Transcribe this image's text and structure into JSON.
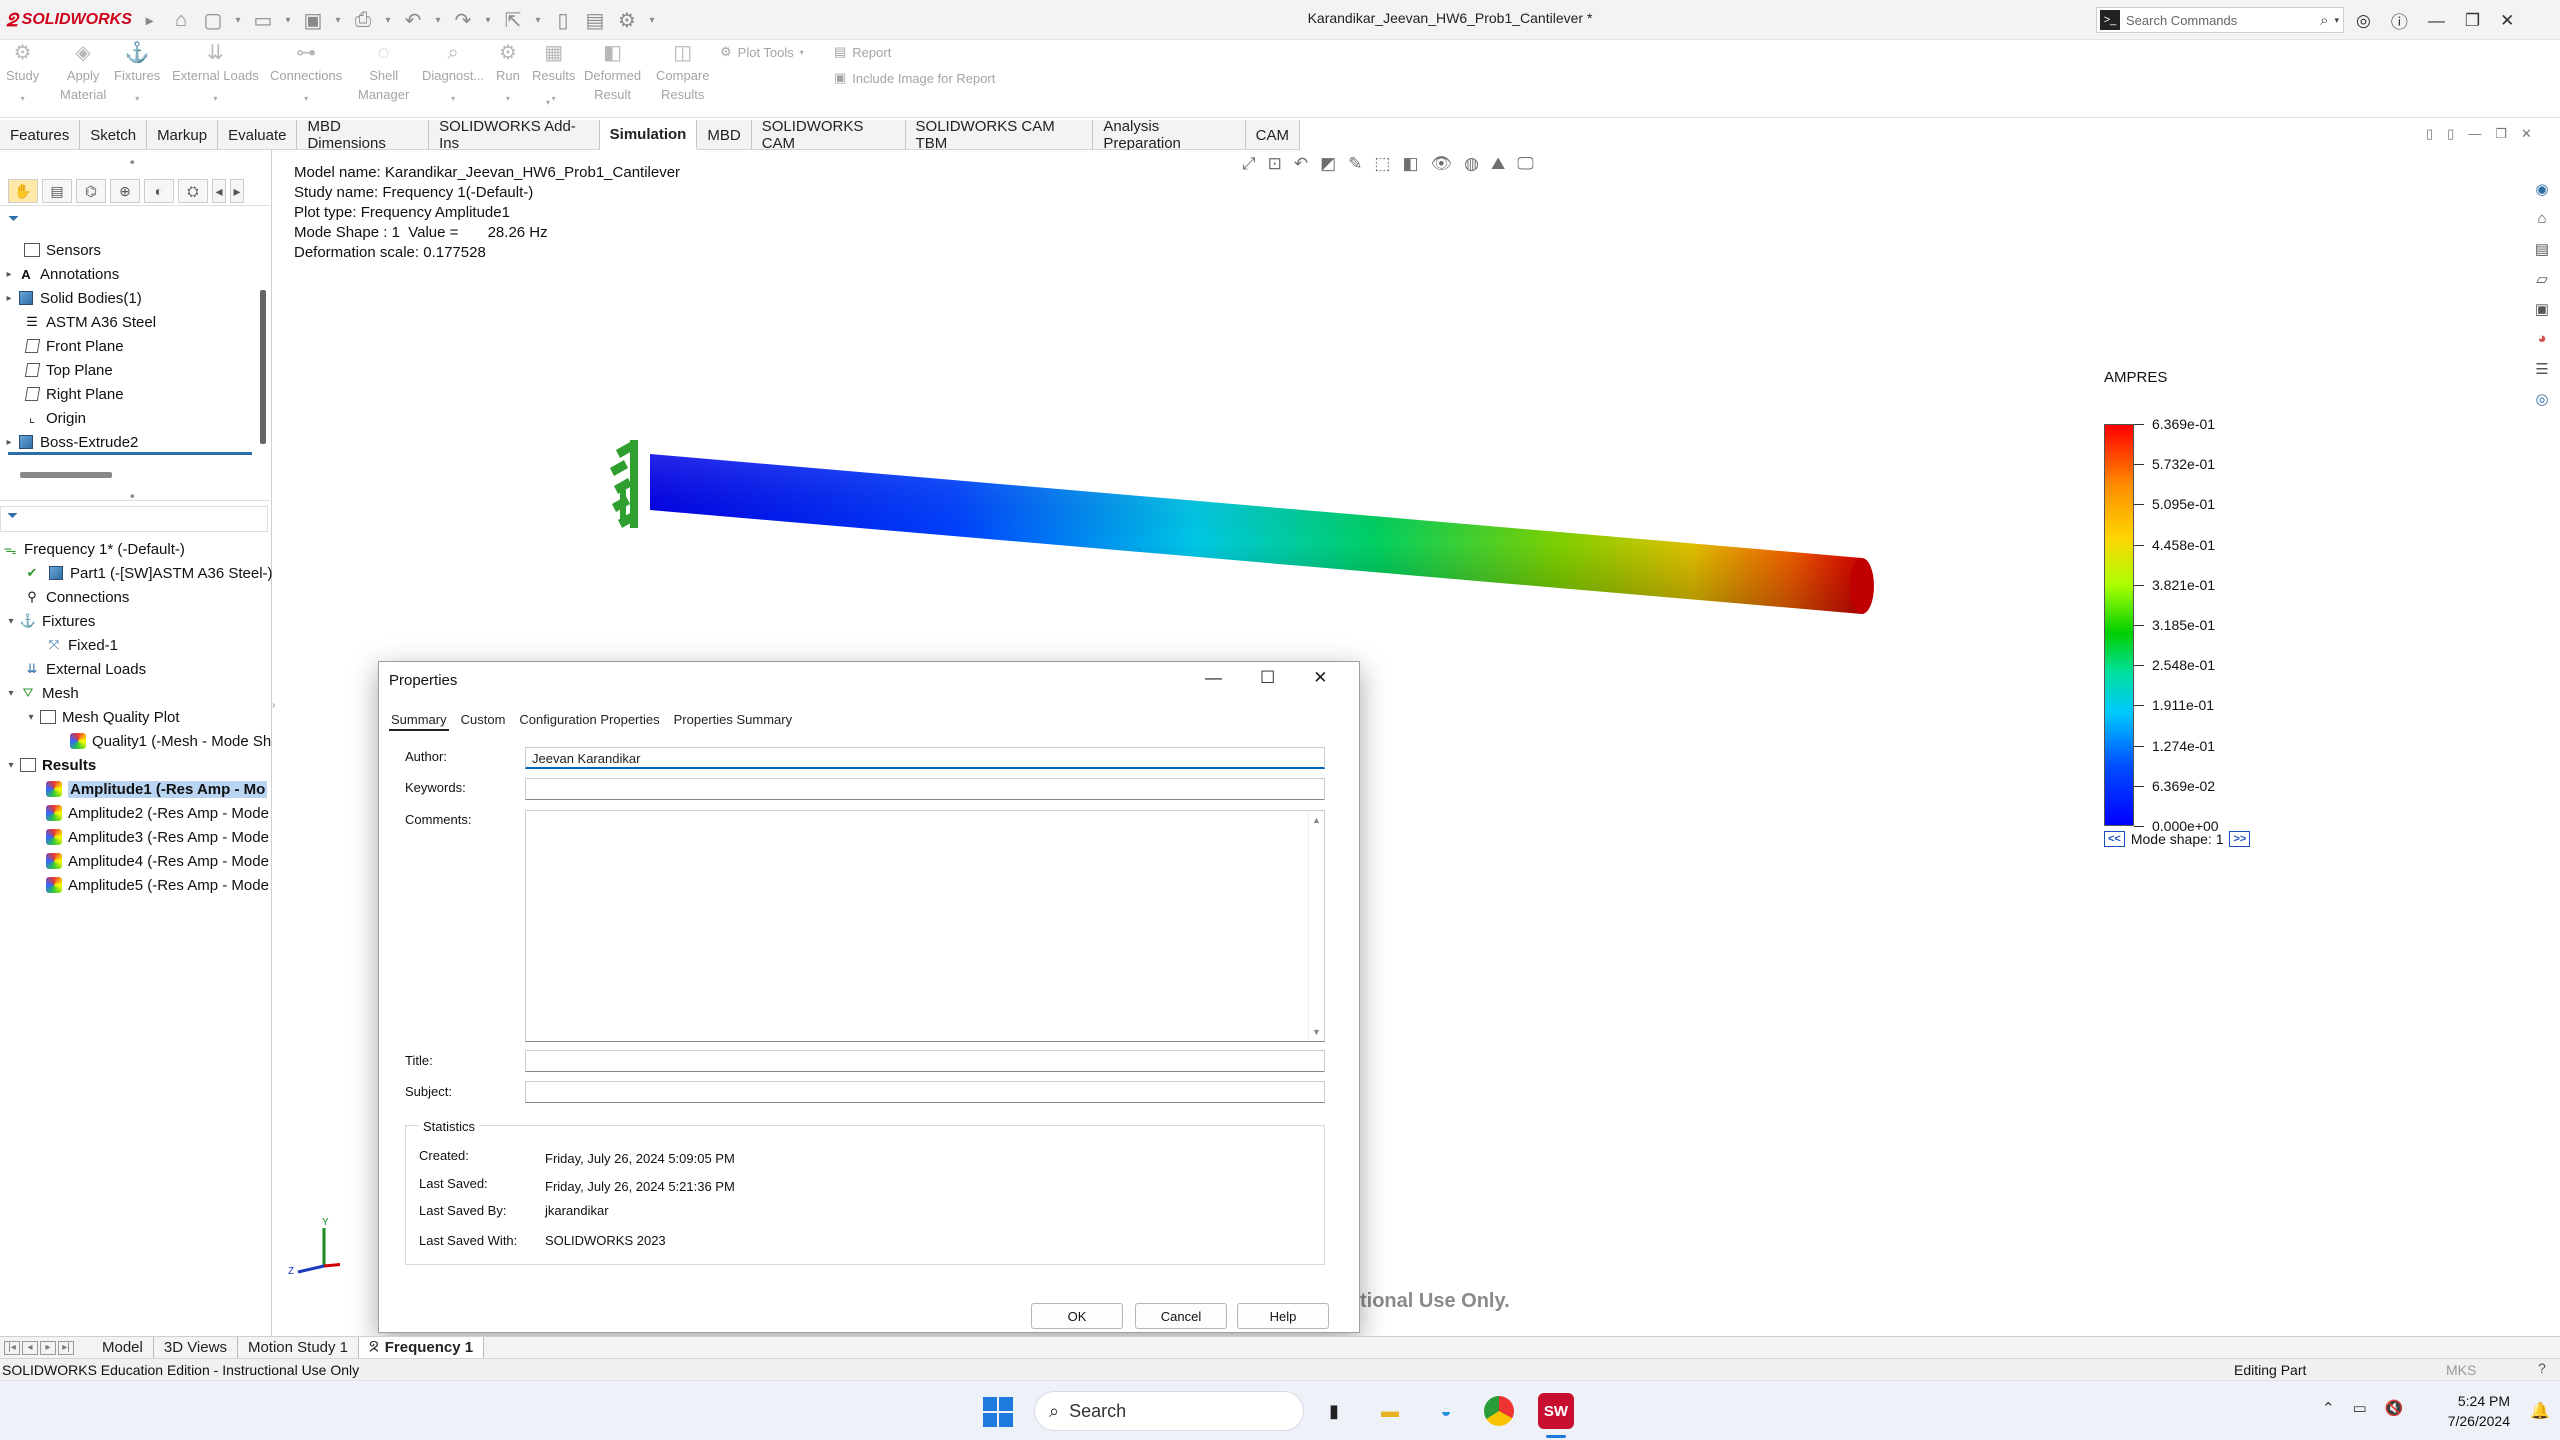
{
  "app": {
    "logo_text": "SOLIDWORKS",
    "doc_title": "Karandikar_Jeevan_HW6_Prob1_Cantilever *",
    "search_placeholder": "Search Commands"
  },
  "command_manager": {
    "buttons": [
      {
        "label": "Study",
        "label2": "",
        "icon": "study-icon"
      },
      {
        "label": "Apply",
        "label2": "Material",
        "icon": "material-icon"
      },
      {
        "label": "Fixtures",
        "label2": "",
        "icon": "fixture-icon"
      },
      {
        "label": "External Loads",
        "label2": "",
        "icon": "load-icon"
      },
      {
        "label": "Connections",
        "label2": "",
        "icon": "connection-icon"
      },
      {
        "label": "Shell",
        "label2": "Manager",
        "icon": "shell-icon"
      },
      {
        "label": "Diagnost...",
        "label2": "",
        "icon": "diagnostic-icon"
      },
      {
        "label": "Run",
        "label2": "",
        "icon": "run-icon"
      },
      {
        "label": "Results",
        "label2": "",
        "icon": "results-icon"
      },
      {
        "label": "Deformed",
        "label2": "Result",
        "icon": "deformed-icon"
      },
      {
        "label": "Compare",
        "label2": "Results",
        "icon": "compare-icon"
      }
    ],
    "plot_tools": "Plot Tools",
    "report": "Report",
    "include_image": "Include Image for Report"
  },
  "tabs": [
    "Features",
    "Sketch",
    "Markup",
    "Evaluate",
    "MBD Dimensions",
    "SOLIDWORKS Add-Ins",
    "Simulation",
    "MBD",
    "SOLIDWORKS CAM",
    "SOLIDWORKS CAM TBM",
    "Analysis Preparation",
    "CAM"
  ],
  "active_tab": "Simulation",
  "feature_tree": [
    {
      "label": "Sensors",
      "twisty": ""
    },
    {
      "label": "Annotations",
      "twisty": "▸"
    },
    {
      "label": "Solid Bodies(1)",
      "twisty": "▸"
    },
    {
      "label": "ASTM A36 Steel",
      "twisty": ""
    },
    {
      "label": "Front Plane",
      "twisty": ""
    },
    {
      "label": "Top Plane",
      "twisty": ""
    },
    {
      "label": "Right Plane",
      "twisty": ""
    },
    {
      "label": "Origin",
      "twisty": ""
    },
    {
      "label": "Boss-Extrude2",
      "twisty": "▸"
    }
  ],
  "sim_tree": {
    "study": "Frequency 1* (-Default-)",
    "part": "Part1 (-[SW]ASTM A36 Steel-)",
    "connections": "Connections",
    "fixtures": "Fixtures",
    "fixed": "Fixed-1",
    "external_loads": "External Loads",
    "mesh": "Mesh",
    "mesh_quality_plot": "Mesh Quality Plot",
    "quality1": "Quality1 (-Mesh - Mode Sh",
    "results": "Results",
    "amplitudes": [
      "Amplitude1 (-Res Amp - Mo",
      "Amplitude2 (-Res Amp - Mode",
      "Amplitude3 (-Res Amp - Mode",
      "Amplitude4 (-Res Amp - Mode",
      "Amplitude5 (-Res Amp - Mode"
    ]
  },
  "info": {
    "model_name": "Model name: Karandikar_Jeevan_HW6_Prob1_Cantilever",
    "study_name": "Study name: Frequency 1(-Default-)",
    "plot_type": "Plot type: Frequency Amplitude1",
    "mode_shape": "Mode Shape : 1  Value =       28.26 Hz",
    "deformation_scale": "Deformation scale: 0.177528"
  },
  "legend": {
    "title": "AMPRES",
    "labels": [
      "6.369e-01",
      "5.732e-01",
      "5.095e-01",
      "4.458e-01",
      "3.821e-01",
      "3.185e-01",
      "2.548e-01",
      "1.911e-01",
      "1.274e-01",
      "6.369e-02",
      "0.000e+00"
    ],
    "prev": "<<",
    "mode_text": "Mode shape: 1",
    "next": ">>"
  },
  "watermark": "tional Use Only.",
  "dialog": {
    "title": "Properties",
    "tabs": [
      "Summary",
      "Custom",
      "Configuration Properties",
      "Properties Summary"
    ],
    "author_label": "Author:",
    "author_value": "Jeevan Karandikar",
    "keywords_label": "Keywords:",
    "keywords_value": "",
    "comments_label": "Comments:",
    "title_label": "Title:",
    "title_value": "",
    "subject_label": "Subject:",
    "subject_value": "",
    "stats_title": "Statistics",
    "created_label": "Created:",
    "created_value": "Friday, July 26, 2024 5:09:05 PM",
    "saved_label": "Last Saved:",
    "saved_value": "Friday, July 26, 2024 5:21:36 PM",
    "saved_by_label": "Last Saved By:",
    "saved_by_value": "jkarandikar",
    "saved_with_label": "Last Saved With:",
    "saved_with_value": "SOLIDWORKS 2023",
    "ok": "OK",
    "cancel": "Cancel",
    "help": "Help"
  },
  "bottom_tabs": [
    "Model",
    "3D Views",
    "Motion Study 1",
    "Frequency 1"
  ],
  "status": {
    "left": "SOLIDWORKS Education Edition - Instructional Use Only",
    "editing": "Editing Part",
    "units": "MKS",
    "help": "?"
  },
  "taskbar": {
    "search": "Search",
    "time": "5:24 PM",
    "date": "7/26/2024"
  }
}
